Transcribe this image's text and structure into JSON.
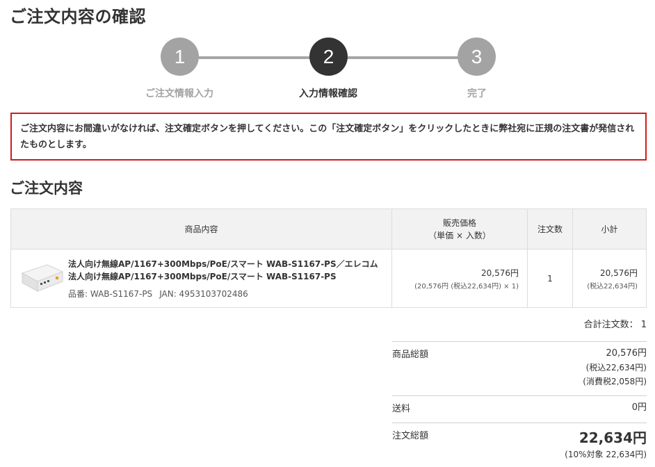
{
  "page": {
    "title": "ご注文内容の確認"
  },
  "stepper": {
    "steps": [
      {
        "number": "1",
        "label": "ご注文情報入力"
      },
      {
        "number": "2",
        "label": "入力情報確認"
      },
      {
        "number": "3",
        "label": "完了"
      }
    ]
  },
  "notice": {
    "text": "ご注文内容にお間違いがなければ、注文確定ボタンを押してください。この「注文確定ボタン」をクリックしたときに弊社宛に正規の注文書が発信されたものとします。"
  },
  "section": {
    "title": "ご注文内容"
  },
  "table": {
    "headers": {
      "product": "商品内容",
      "price_line1": "販売価格",
      "price_line2": "（単価 × 入数）",
      "qty": "注文数",
      "subtotal": "小計"
    },
    "rows": [
      {
        "name": "法人向け無線AP/1167+300Mbps/PoE/スマート WAB-S1167-PS／エレコム 法人向け無線AP/1167+300Mbps/PoE/スマート WAB-S1167-PS",
        "part": "品番: WAB-S1167-PS",
        "jan": "JAN: 4953103702486",
        "price": "20,576円",
        "price_detail": "(20,576円 (税込22,634円) × 1)",
        "qty": "1",
        "subtotal": "20,576円",
        "subtotal_tax": "(税込22,634円)"
      }
    ]
  },
  "summary": {
    "total_count": "合計注文数： 1",
    "goods_label": "商品総額",
    "goods_value": "20,576円",
    "goods_tax_incl": "(税込22,634円)",
    "goods_tax": "(消費税2,058円)",
    "shipping_label": "送料",
    "shipping_value": "0円",
    "order_label": "注文総額",
    "order_value": "22,634円",
    "order_note": "(10%対象 22,634円)"
  },
  "colors": {
    "accent_red": "#d11c1c",
    "step_active": "#333333",
    "step_inactive": "#a3a3a3"
  }
}
